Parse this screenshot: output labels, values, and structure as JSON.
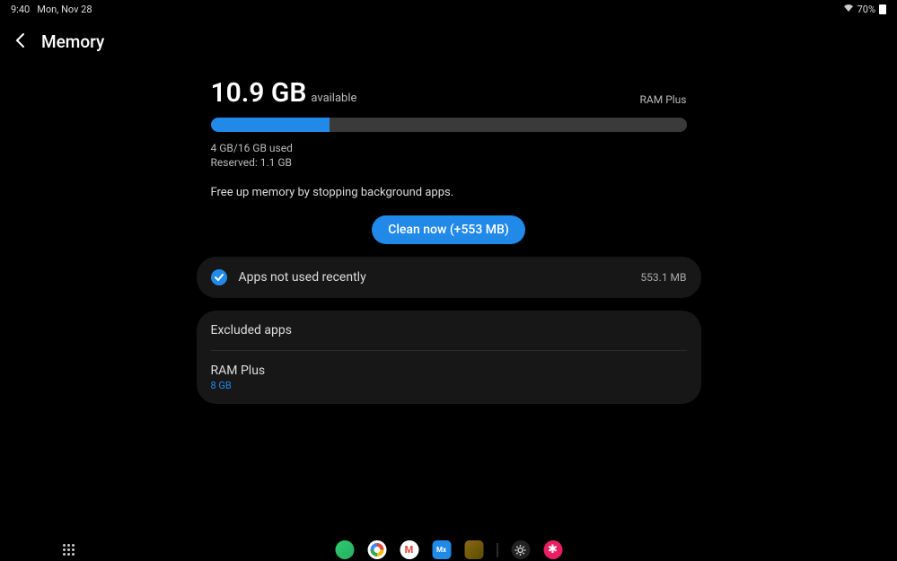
{
  "status_bar": {
    "time": "9:40",
    "date": "Mon, Nov 28",
    "battery": "70%"
  },
  "header": {
    "title": "Memory"
  },
  "memory": {
    "available_value": "10.9 GB",
    "available_label": "available",
    "ram_plus_label": "RAM Plus",
    "progress_percent": 25,
    "usage_line1": "4 GB/16 GB used",
    "usage_line2": "Reserved: 1.1 GB",
    "hint": "Free up memory by stopping background apps.",
    "clean_button": "Clean now (+553 MB)"
  },
  "apps_section": {
    "label": "Apps not used recently",
    "size": "553.1 MB"
  },
  "options": {
    "excluded_apps": "Excluded apps",
    "ram_plus_title": "RAM Plus",
    "ram_plus_value": "8 GB"
  }
}
